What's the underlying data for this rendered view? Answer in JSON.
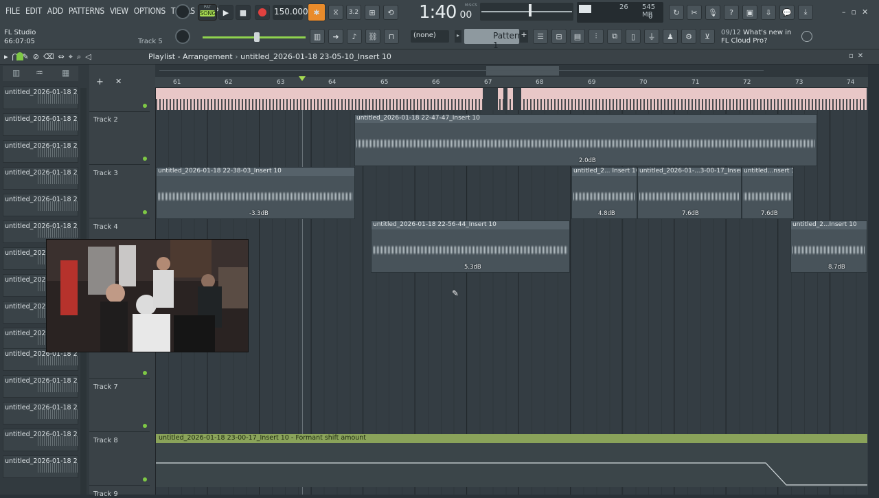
{
  "menu": [
    "FILE",
    "EDIT",
    "ADD",
    "PATTERNS",
    "VIEW",
    "OPTIONS",
    "TOOLS",
    "HELP"
  ],
  "transport": {
    "mode_pat": "PAT",
    "mode_song": "SONG",
    "tempo": "150.000",
    "time": "1:40",
    "time_sub": "00",
    "time_label": "M:S:CS",
    "cpu": "26",
    "memory": "545 MB",
    "polyphony": "0"
  },
  "project": {
    "app_name": "FL Studio",
    "elapsed": "66:07:05",
    "hint_track": "Track 5"
  },
  "pattern": {
    "channel": "(none)",
    "name": "Pattern 1"
  },
  "news": {
    "date": "09/12",
    "text": "What's new in FL Cloud Pro?"
  },
  "playlist": {
    "title": "Playlist - Arrangement",
    "arrangement": "untitled_2026-01-18 23-05-10_Insert 10"
  },
  "ruler": [
    "61",
    "62",
    "63",
    "64",
    "65",
    "66",
    "67",
    "68",
    "69",
    "70",
    "71",
    "72",
    "73",
    "74"
  ],
  "pattern_list": [
    "untitled_2026-01-18 22-...",
    "untitled_2026-01-18 22-...",
    "untitled_2026-01-18 22-...",
    "untitled_2026-01-18 22-...",
    "untitled_2026-01-18 22-...",
    "untitled_2026-01-18 22-...",
    "untitled_2026-0",
    "untitled_2026-0",
    "untitled_2026-0",
    "untitled_2026-0",
    "untitled_2026-01-18 22-...",
    "untitled_2026-01-18 22-...",
    "untitled_2026-01-18 23-...",
    "untitled_2026-01-18 23-...",
    "untitled_2026-01-18 23-..."
  ],
  "tracks": [
    "",
    "Track 2",
    "Track 3",
    "Track 4",
    "",
    "",
    "Track 7",
    "Track 8",
    "Track 9"
  ],
  "clips": [
    {
      "label": "untitled_2026-01-18 22-47-47_Insert 10",
      "gain": "2.0dB"
    },
    {
      "label": "untitled_2026-01-18 22-38-03_Insert 10",
      "gain": "-3.3dB"
    },
    {
      "label": "untitled_2... Insert 10",
      "gain": "4.8dB"
    },
    {
      "label": "untitled_2026-01-...3-00-17_Insert 10",
      "gain": "7.6dB"
    },
    {
      "label": "untitled...nsert 10",
      "gain": "7.6dB"
    },
    {
      "label": "untitled_2026-01-18 22-56-44_Insert 10",
      "gain": "5.3dB"
    },
    {
      "label": "untitled_2...Insert 10",
      "gain": "8.7dB"
    }
  ],
  "automation": {
    "label": "untitled_2026-01-18 23-00-17_Insert 10 - Formant shift amount"
  },
  "colors": {
    "accent_green": "#7ec845",
    "clip": "#48535a",
    "top_track": "#e8c7c7",
    "automation": "#8aa35a"
  }
}
